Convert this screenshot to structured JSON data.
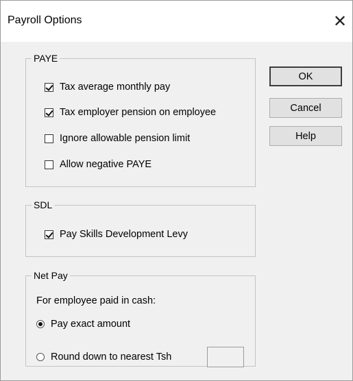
{
  "window": {
    "title": "Payroll Options",
    "close_glyph": "✕"
  },
  "paye": {
    "legend": "PAYE",
    "options": [
      {
        "label": "Tax average monthly pay",
        "checked": true
      },
      {
        "label": "Tax employer pension on employee",
        "checked": true
      },
      {
        "label": "Ignore allowable pension limit",
        "checked": false
      },
      {
        "label": "Allow negative PAYE",
        "checked": false
      }
    ]
  },
  "sdl": {
    "legend": "SDL",
    "options": [
      {
        "label": "Pay Skills Development Levy",
        "checked": true
      }
    ]
  },
  "netpay": {
    "legend": "Net Pay",
    "caption": "For employee paid in cash:",
    "radios": [
      {
        "label": "Pay exact amount",
        "selected": true
      },
      {
        "label": "Round down to nearest Tsh",
        "selected": false
      }
    ],
    "round_value": ""
  },
  "buttons": {
    "ok": "OK",
    "cancel": "Cancel",
    "help": "Help"
  }
}
